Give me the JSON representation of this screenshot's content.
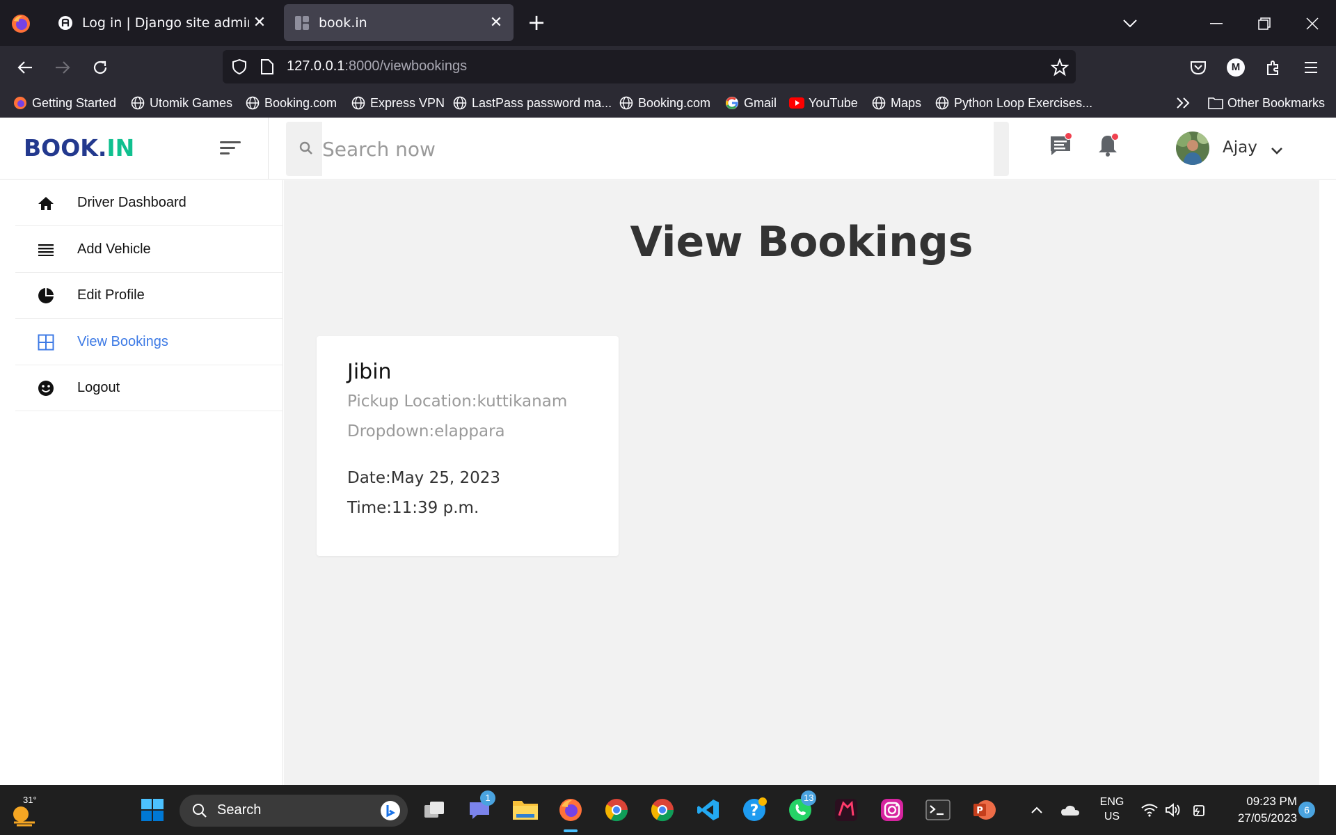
{
  "browser": {
    "tabs": [
      {
        "title": "Log in | Django site admin",
        "active": false
      },
      {
        "title": "book.in",
        "active": true
      }
    ],
    "url": {
      "host": "127.0.0.1",
      "rest": ":8000/viewbookings"
    },
    "bookmarks": [
      {
        "label": "Getting Started",
        "icon": "firefox-icon"
      },
      {
        "label": "Utomik Games",
        "icon": "globe-icon"
      },
      {
        "label": "Booking.com",
        "icon": "globe-icon"
      },
      {
        "label": "Express VPN",
        "icon": "globe-icon"
      },
      {
        "label": "LastPass password ma...",
        "icon": "globe-icon"
      },
      {
        "label": "Booking.com",
        "icon": "globe-icon"
      },
      {
        "label": "Gmail",
        "icon": "google-icon"
      },
      {
        "label": "YouTube",
        "icon": "youtube-icon"
      },
      {
        "label": "Maps",
        "icon": "globe-icon"
      },
      {
        "label": "Python Loop Exercises...",
        "icon": "globe-icon"
      }
    ],
    "other_bookmarks": "Other Bookmarks",
    "profile_initial": "M"
  },
  "app": {
    "logo_part1": "BOOK.",
    "logo_part2": "IN",
    "search_placeholder": "Search now",
    "user_name": "Ajay",
    "colors": {
      "logo_blue": "#23398e",
      "logo_green": "#10c08f",
      "active_link": "#3d7ae5",
      "notification_dot": "#f0414f"
    }
  },
  "sidebar": {
    "items": [
      {
        "label": "Driver Dashboard",
        "icon": "home-icon",
        "active": false
      },
      {
        "label": "Add Vehicle",
        "icon": "list-icon",
        "active": false
      },
      {
        "label": "Edit Profile",
        "icon": "pie-chart-icon",
        "active": false
      },
      {
        "label": "View Bookings",
        "icon": "grid-icon",
        "active": true
      },
      {
        "label": "Logout",
        "icon": "smiley-icon",
        "active": false
      }
    ]
  },
  "main": {
    "title": "View Bookings",
    "bookings": [
      {
        "name": "Jibin",
        "pickup": "Pickup Location:kuttikanam",
        "dropdown": "Dropdown:elappara",
        "date": "Date:May 25, 2023",
        "time": "Time:11:39 p.m."
      }
    ]
  },
  "taskbar": {
    "weather_temp": "31°",
    "search_label": "Search",
    "badges": {
      "teams": "1",
      "whatsapp": "13"
    },
    "lang_line1": "ENG",
    "lang_line2": "US",
    "time": "09:23 PM",
    "date": "27/05/2023",
    "notification_count": "6"
  }
}
